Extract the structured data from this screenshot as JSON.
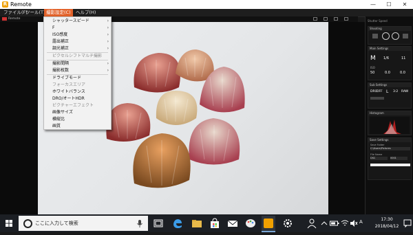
{
  "window": {
    "title": "Remote",
    "app_icon": "R",
    "minimize": "—",
    "maximize": "☐",
    "close": "✕"
  },
  "menubar": [
    {
      "label": "ファイル(F)",
      "active": false
    },
    {
      "label": "ツール(T)",
      "active": false
    },
    {
      "label": "撮影設定(C)",
      "active": true
    },
    {
      "label": "ヘルプ(H)",
      "active": false
    }
  ],
  "strip": {
    "label": "Remote"
  },
  "dropdown": {
    "items": [
      {
        "label": "シャッタースピード",
        "submenu": true,
        "disabled": false
      },
      {
        "label": "F",
        "submenu": true,
        "disabled": false
      },
      {
        "label": "ISO感度",
        "submenu": true,
        "disabled": false
      },
      {
        "label": "露出補正",
        "submenu": true,
        "disabled": false
      },
      {
        "label": "調光補正",
        "submenu": true,
        "disabled": false
      },
      {
        "label": "ピクセルシフトマルチ撮影",
        "submenu": false,
        "disabled": true
      },
      {
        "label": "撮影間隔",
        "submenu": true,
        "disabled": false
      },
      {
        "label": "撮影枚数",
        "submenu": true,
        "disabled": false
      },
      {
        "label": "ドライブモード",
        "submenu": false,
        "disabled": false
      },
      {
        "label": "フォーカスエリア",
        "submenu": false,
        "disabled": true
      },
      {
        "label": "ホワイトバランス",
        "submenu": false,
        "disabled": false
      },
      {
        "label": "DRO/オートHDR",
        "submenu": false,
        "disabled": false
      },
      {
        "label": "ピクチャーエフェクト",
        "submenu": false,
        "disabled": true
      },
      {
        "label": "画像サイズ",
        "submenu": false,
        "disabled": false
      },
      {
        "label": "横縦比",
        "submenu": false,
        "disabled": false
      },
      {
        "label": "画質",
        "submenu": false,
        "disabled": false
      }
    ],
    "arrow": "›"
  },
  "panel": {
    "shooting": {
      "title": "Shooting"
    },
    "main_settings": {
      "title": "Main Settings",
      "mode": "M",
      "shutter": "1/6",
      "f": "11",
      "iso": "50",
      "iso_label": "ISO",
      "ev1": "0.0",
      "ev2": "0.0",
      "shutter_label": "Shutter Speed"
    },
    "sub_settings": {
      "title": "Sub Settings",
      "hdr": "DRO",
      "hdr_val": "OFF",
      "size": "L",
      "ratio": "3:2",
      "quality": "RAW"
    },
    "histogram": {
      "title": "Histogram"
    },
    "save_settings": {
      "title": "Save Settings",
      "folder": "C:\\Users\\Pictures",
      "filename": "DSC",
      "digits": "0001",
      "label_folder": "Save Folder",
      "label_name": "File Name"
    }
  },
  "taskbar": {
    "search_placeholder": "ここに入力して検索",
    "time": "17:30",
    "date": "2018/04/12",
    "lang": "A"
  }
}
